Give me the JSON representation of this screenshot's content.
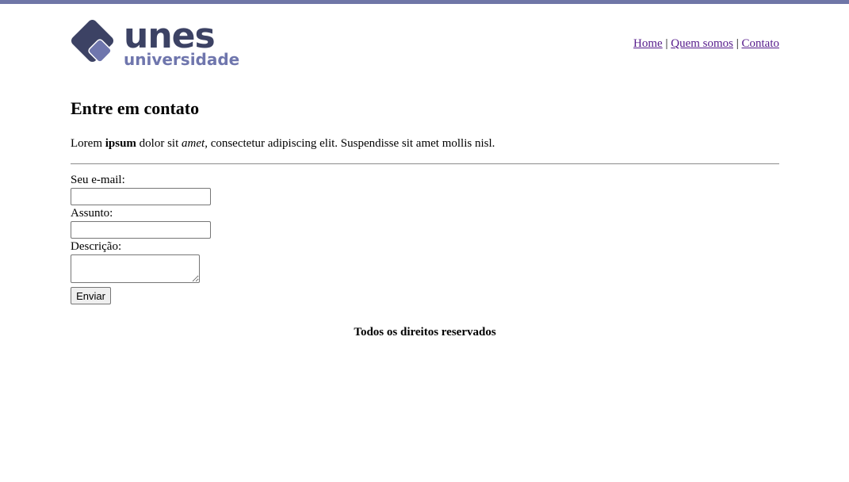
{
  "brand": {
    "name": "unes",
    "subtitle": "universidade",
    "primary_color": "#3c4264",
    "accent_color": "#6f76ad",
    "topbar_color": "#6f76a7"
  },
  "nav": {
    "items": [
      {
        "label": "Home"
      },
      {
        "label": "Quem somos"
      },
      {
        "label": "Contato"
      }
    ],
    "separator": "|"
  },
  "main": {
    "title": "Entre em contato",
    "intro": {
      "part1": "Lorem ",
      "bold": "ipsum",
      "part2": " dolor sit ",
      "italic": "amet",
      "part3": ", consectetur adipiscing elit. Suspendisse sit amet mollis nisl."
    }
  },
  "form": {
    "email_label": "Seu e-mail:",
    "email_value": "",
    "subject_label": "Assunto:",
    "subject_value": "",
    "description_label": "Descrição:",
    "description_value": "",
    "submit_label": "Enviar"
  },
  "footer": {
    "text": "Todos os direitos reservados"
  }
}
